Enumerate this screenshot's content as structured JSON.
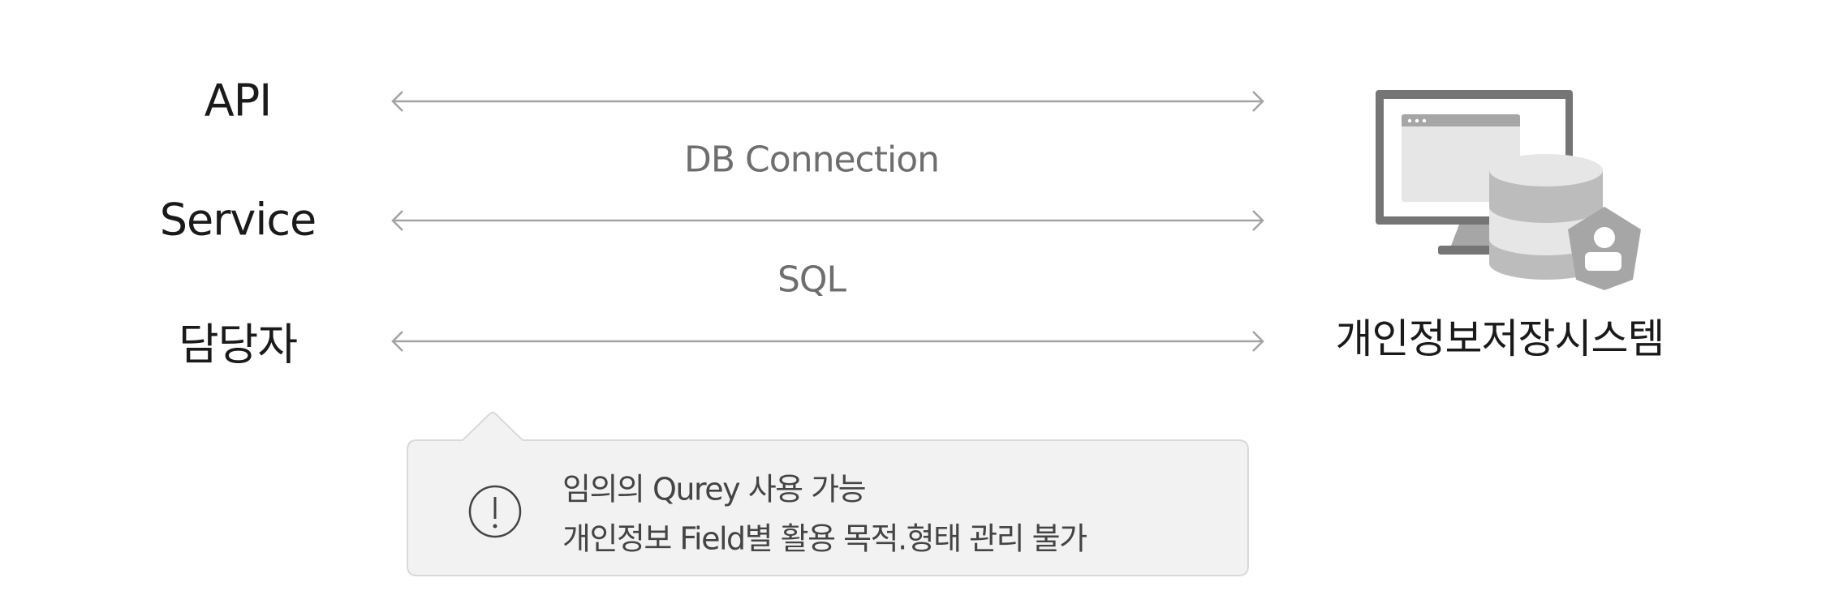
{
  "left_labels": [
    "API",
    "Service",
    "담당자"
  ],
  "connections": [
    "DB Connection",
    "SQL"
  ],
  "target": {
    "label": "개인정보저장시스템",
    "icon": "database-monitor-shield-icon"
  },
  "callout": {
    "icon": "exclamation-circle-icon",
    "lines": [
      "임의의 Qurey 사용 가능",
      "개인정보 Field별 활용 목적.형태 관리 불가"
    ]
  },
  "colors": {
    "arrow": "#a3a3a3",
    "callout_bg": "#f2f2f2",
    "callout_border": "#d9d9d9"
  }
}
